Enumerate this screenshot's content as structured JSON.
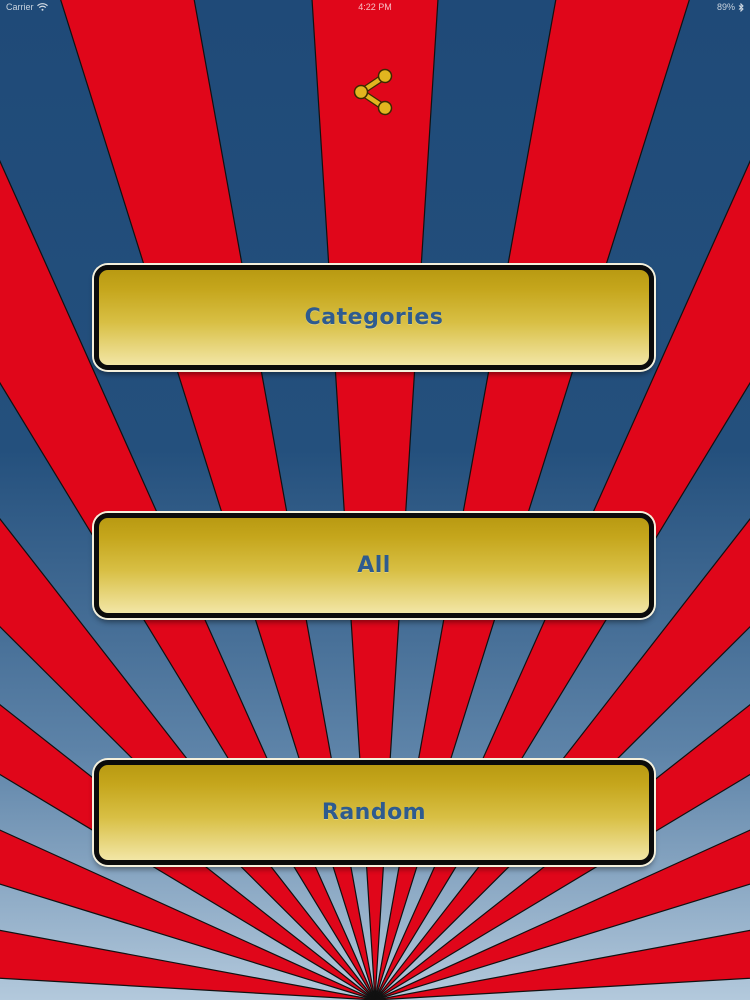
{
  "status_bar": {
    "carrier": "Carrier",
    "time": "4:22 PM",
    "battery": "89%"
  },
  "share": {
    "icon": "share-icon"
  },
  "menu": {
    "categories_label": "Categories",
    "all_label": "All",
    "random_label": "Random"
  },
  "colors": {
    "ray_red": "#e0061a",
    "sky_top": "#1f4a78",
    "sky_bottom": "#b3c9dc",
    "button_gold": "#c5a61c",
    "button_text": "#2e5b8f",
    "button_border": "#0b0b0b",
    "share_icon": "#e2b51f"
  }
}
